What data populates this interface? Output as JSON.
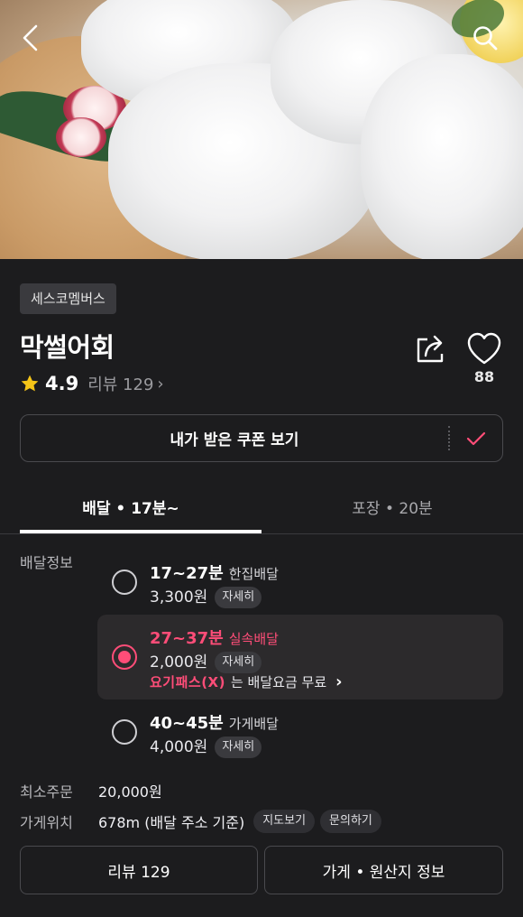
{
  "header": {
    "back_icon": "chevron-left-icon",
    "search_icon": "search-icon"
  },
  "store": {
    "category": "세스코멤버스",
    "name": "막썰어회",
    "rating": "4.9",
    "review_label": "리뷰 129",
    "review_chevron": "›",
    "like_count": "88"
  },
  "coupon": {
    "label": "내가 받은 쿠폰 보기"
  },
  "tabs": [
    {
      "label": "배달 • 17분~",
      "active": true
    },
    {
      "label": "포장 • 20분",
      "active": false
    }
  ],
  "delivery": {
    "section_label": "배달정보",
    "detail_label": "자세히",
    "options": [
      {
        "time": "17~27분",
        "type": "한집배달",
        "price": "3,300원",
        "selected": false
      },
      {
        "time": "27~37분",
        "type": "실속배달",
        "price": "2,000원",
        "selected": true
      },
      {
        "time": "40~45분",
        "type": "가게배달",
        "price": "4,000원",
        "selected": false
      }
    ],
    "pass": {
      "logo": "요기패스(X)",
      "text": "는 배달요금 무료",
      "chevron": "›"
    }
  },
  "info": {
    "min_order_label": "최소주문",
    "min_order_value": "20,000원",
    "location_label": "가게위치",
    "location_value": "678m (배달 주소 기준)",
    "map_chip": "지도보기",
    "inquiry_chip": "문의하기"
  },
  "bottom": {
    "review_button": "리뷰 129",
    "info_button": "가게 • 원산지 정보"
  },
  "colors": {
    "background": "#1c1c1e",
    "accent": "#ff4d78",
    "star": "#f5c518"
  }
}
